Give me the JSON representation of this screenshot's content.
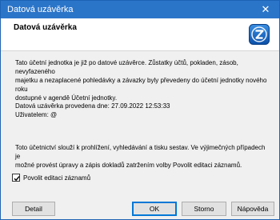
{
  "window": {
    "title": "Datová uzávěrka",
    "close_symbol": "✕"
  },
  "header": {
    "title": "Datová uzávěrka",
    "logo_icon": "z-logo-icon"
  },
  "body": {
    "paragraph1_lines": [
      "Tato účetní jednotka je již po datové uzávěrce. Zůstatky účtů, pokladen, zásob, nevyfazeného",
      "majetku a nezaplacené pohledávky a závazky byly převedeny do účetní jednotky nového roku",
      "dostupné v agendě Účetní jednotky."
    ],
    "closing_line": "Datová uzávěrka provedena dne: 27.09.2022 12:53:33",
    "user_line": "Uživatelem: @",
    "paragraph2_lines": [
      "Toto účetnictví slouží k prohlížení, vyhledávání a tisku sestav. Ve výjimečných případech je",
      "možné provést úpravy a zápis dokladů zatržením volby Povolit editaci záznamů."
    ]
  },
  "checkbox": {
    "label": "Povolit editaci záznamů",
    "checked": true
  },
  "buttons": {
    "detail": "Detail",
    "ok": "OK",
    "cancel": "Storno",
    "help": "Nápověda"
  },
  "colors": {
    "titlebar": "#2b75c9",
    "accent": "#0078d7"
  }
}
